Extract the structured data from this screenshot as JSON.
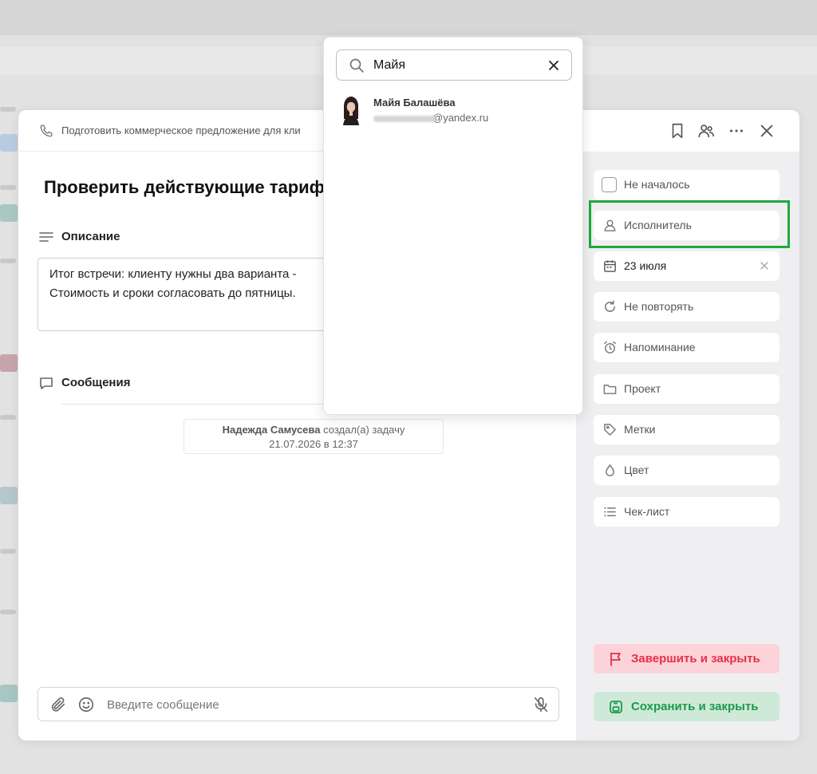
{
  "modal": {
    "parent_task": "Подготовить коммерческое предложение для кли",
    "title": "Проверить действующие тариф",
    "description_label": "Описание",
    "description_lines": [
      "Итог встречи: клиенту нужны два варианта -",
      "Стоимость и сроки согласовать до пятницы."
    ],
    "messages_label": "Сообщения",
    "event": {
      "author": "Надежда Самусева",
      "action": "создал(а) задачу",
      "datetime": "21.07.2026 в 12:37"
    },
    "composer_placeholder": "Введите сообщение"
  },
  "sidebar": {
    "status": "Не началось",
    "assignee": "Исполнитель",
    "due_date": "23 июля",
    "repeat": "Не повторять",
    "reminder": "Напоминание",
    "project": "Проект",
    "tags": "Метки",
    "color": "Цвет",
    "checklist": "Чек-лист",
    "finish_button": "Завершить и закрыть",
    "save_button": "Сохранить и закрыть"
  },
  "dropdown": {
    "search_value": "Майя",
    "results": [
      {
        "name": "Майя Балашёва",
        "email_suffix": "@yandex.ru"
      }
    ]
  },
  "colors": {
    "highlight": "#1faa3a",
    "finish_text": "#e5304a",
    "finish_bg": "#fcd3d8",
    "save_text": "#1a9a4a",
    "save_bg": "#cfe9d9",
    "sidebar_bg": "#efeff1"
  },
  "icons": [
    "phone-icon",
    "bookmark-icon",
    "users-icon",
    "more-icon",
    "close-icon",
    "description-icon",
    "chat-icon",
    "paperclip-icon",
    "smile-icon",
    "mic-off-icon",
    "user-icon",
    "calendar-icon",
    "repeat-icon",
    "alarm-icon",
    "folder-icon",
    "tag-icon",
    "drop-icon",
    "checklist-icon",
    "flag-icon",
    "save-icon",
    "search-icon",
    "clear-icon"
  ]
}
